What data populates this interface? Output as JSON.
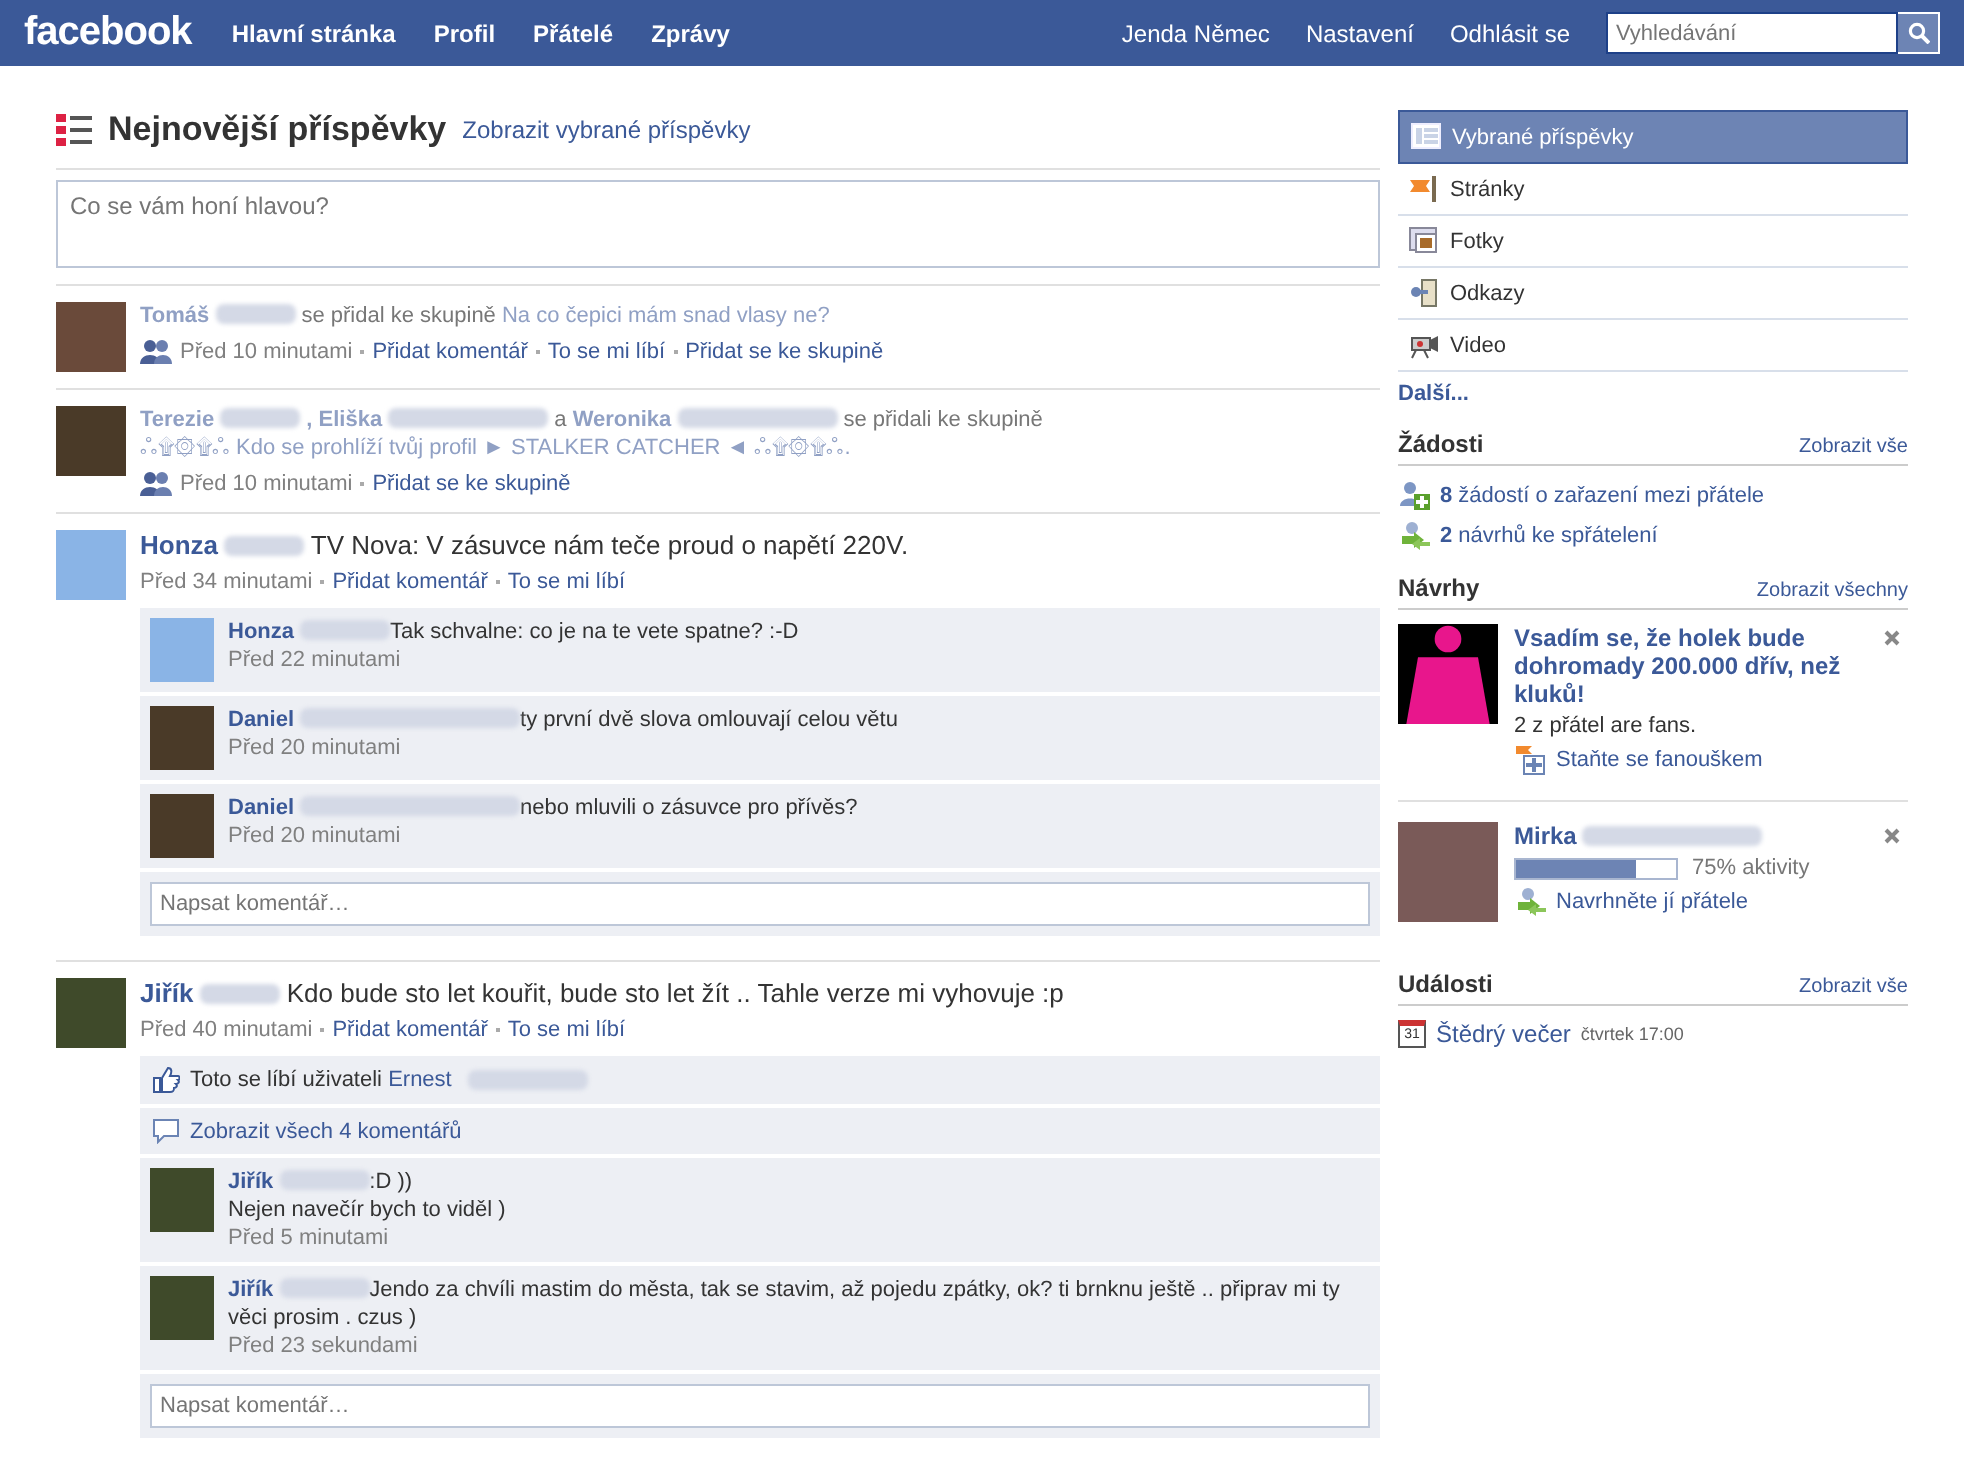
{
  "header": {
    "logo": "facebook",
    "nav": [
      "Hlavní stránka",
      "Profil",
      "Přátelé",
      "Zprávy"
    ],
    "user_links": [
      "Jenda Němec",
      "Nastavení",
      "Odhlásit se"
    ],
    "search": {
      "placeholder": "Vyhledávání"
    }
  },
  "feed": {
    "title": "Nejnovější příspěvky",
    "filter_link": "Zobrazit vybrané příspěvky",
    "composer": {
      "placeholder": "Co se vám honí hlavou?"
    },
    "stories": [
      {
        "kind": "group_join",
        "line": [
          {
            "kind": "actor",
            "text": "Tomáš"
          },
          {
            "kind": "plain",
            "text": "se přidal ke skupině"
          },
          {
            "kind": "group",
            "text": "Na co čepici mám snad vlasy ne?"
          }
        ],
        "time": "Před 10 minutami",
        "actions": [
          "Přidat komentář",
          "To se mi líbí",
          "Přidat se ke skupině"
        ]
      },
      {
        "kind": "group_join",
        "line": [
          {
            "kind": "actor",
            "text": "Terezie"
          },
          {
            "kind": "actor",
            "text": ", Eliška"
          },
          {
            "kind": "plain",
            "text": "a"
          },
          {
            "kind": "actor",
            "text": "Weronika"
          },
          {
            "kind": "plain",
            "text": "se přidali ke skupině"
          },
          {
            "kind": "group",
            "text": "ஃ۩۞۩ஃ Kdo se prohlíží tvůj profil ► STALKER CATCHER ◄ ஃ۩۞۩ஃ."
          }
        ],
        "time": "Před 10 minutami",
        "actions": [
          "Přidat se ke skupině"
        ]
      },
      {
        "kind": "status",
        "author": "Honza",
        "text": "TV Nova: V zásuvce nám teče proud o napětí 220V.",
        "time": "Před 34 minutami",
        "actions": [
          "Přidat komentář",
          "To se mi líbí"
        ],
        "comments": [
          {
            "author": "Honza",
            "text": "Tak schvalne: co je na te vete spatne? :-D",
            "time": "Před 22 minutami"
          },
          {
            "author": "Daniel",
            "text": "ty první dvě slova omlouvají celou větu",
            "time": "Před 20 minutami"
          },
          {
            "author": "Daniel",
            "text": "nebo mluvili o zásuvce pro přívěs?",
            "time": "Před 20 minutami"
          }
        ],
        "comment_placeholder": "Napsat komentář…"
      },
      {
        "kind": "status",
        "author": "Jiřík",
        "text": "Kdo bude sto let kouřit, bude sto let žít .. Tahle verze mi vyhovuje :p",
        "time": "Před 40 minutami",
        "actions": [
          "Přidat komentář",
          "To se mi líbí"
        ],
        "likes": {
          "text": "Toto se líbí uživateli",
          "name": "Ernest"
        },
        "show_all": "Zobrazit všech 4 komentářů",
        "comments": [
          {
            "author": "Jiřík",
            "text": ":D ))\nNejen navečír bych to viděl )",
            "time": "Před 5 minutami"
          },
          {
            "author": "Jiřík",
            "text": "Jendo za chvíli mastim do města, tak se stavim, až pojedu zpátky, ok? ti brnknu ještě .. připrav mi ty věci prosim . czus )",
            "time": "Před 23 sekundami"
          }
        ],
        "comment_placeholder": "Napsat komentář…"
      }
    ]
  },
  "sidebar": {
    "filters": [
      {
        "label": "Vybrané příspěvky",
        "kind": "list",
        "selected": true
      },
      {
        "label": "Stránky",
        "kind": "flag",
        "selected": false
      },
      {
        "label": "Fotky",
        "kind": "photo",
        "selected": false
      },
      {
        "label": "Odkazy",
        "kind": "link",
        "selected": false
      },
      {
        "label": "Video",
        "kind": "video",
        "selected": false
      }
    ],
    "more": "Další...",
    "requests": {
      "title": "Žádosti",
      "link": "Zobrazit vše",
      "items": [
        {
          "kind": "add",
          "count": "8",
          "text": "žádostí o zařazení mezi přátele"
        },
        {
          "kind": "suggest",
          "count": "2",
          "text": "návrhů ke spřátelení"
        }
      ]
    },
    "suggestions": {
      "title": "Návrhy",
      "link": "Zobrazit všechny",
      "items": [
        {
          "kind": "page",
          "title": "Vsadím se, že holek bude dohromady 200.000 dřív, než kluků!",
          "subtitle": "2 z přátel are fans.",
          "action": "Staňte se fanouškem"
        },
        {
          "kind": "person",
          "name": "Mirka",
          "level": 0.75,
          "reading": "75% aktivity",
          "action": "Navrhněte jí přátele"
        }
      ]
    },
    "events": {
      "title": "Události",
      "link": "Zobrazit vše",
      "items": [
        {
          "day": "31",
          "name": "Štědrý večer",
          "when": "čtvrtek 17:00"
        }
      ]
    }
  }
}
